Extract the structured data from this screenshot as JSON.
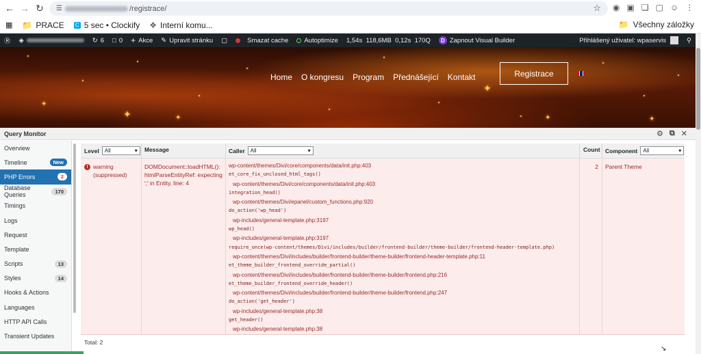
{
  "browser": {
    "url_path": "/registrace/",
    "bookmarks": [
      {
        "label": "PRACE",
        "icon": "folder-icon"
      },
      {
        "label": "5 sec • Clockify",
        "icon": "clockify-icon"
      },
      {
        "label": "Interní komu...",
        "icon": "sparkle-icon"
      }
    ],
    "all_bookmarks": "Všechny záložky"
  },
  "adminbar": {
    "comments": "0",
    "updates": "6",
    "new": "Akce",
    "edit": "Upravit stránku",
    "clear_cache": "Smazat cache",
    "autoptimize": "Autoptimize",
    "stats": "1,54s  118,6MB  0,12s  170Q",
    "visual_builder": "Zapnout Visual Builder",
    "logged_in": "Přihlášený uživatel: wpaservis"
  },
  "site_nav": {
    "items": [
      "Home",
      "O kongresu",
      "Program",
      "Přednášející",
      "Kontakt"
    ],
    "register": "Registrace"
  },
  "qm": {
    "title": "Query Monitor",
    "sidebar": [
      {
        "label": "Overview",
        "badge": ""
      },
      {
        "label": "Timeline",
        "badge": "New",
        "badge_style": "blue"
      },
      {
        "label": "PHP Errors",
        "badge": "2",
        "active": true,
        "badge_style": "red"
      },
      {
        "label": "Database Queries",
        "badge": "170"
      },
      {
        "label": "Timings",
        "badge": ""
      },
      {
        "label": "Logs",
        "badge": ""
      },
      {
        "label": "Request",
        "badge": ""
      },
      {
        "label": "Template",
        "badge": ""
      },
      {
        "label": "Scripts",
        "badge": "13"
      },
      {
        "label": "Styles",
        "badge": "14"
      },
      {
        "label": "Hooks & Actions",
        "badge": ""
      },
      {
        "label": "Languages",
        "badge": ""
      },
      {
        "label": "HTTP API Calls",
        "badge": ""
      },
      {
        "label": "Transient Updates",
        "badge": ""
      }
    ],
    "columns": {
      "level": "Level",
      "level_filter": "All",
      "message": "Message",
      "caller": "Caller",
      "caller_filter": "All",
      "count": "Count",
      "component": "Component",
      "component_filter": "All"
    },
    "error": {
      "level": "warning",
      "level_note": "(suppressed)",
      "message": "DOMDocument::loadHTML(): htmlParseEntityRef: expecting ';' in Entity, line: 4",
      "count": "2",
      "component": "Parent Theme",
      "caller": [
        {
          "t": "path",
          "text": "wp-content/themes/Divi/core/components/data/init.php:403",
          "indent": false
        },
        {
          "t": "fn",
          "text": "et_core_fix_unclosed_html_tags()"
        },
        {
          "t": "path",
          "text": "wp-content/themes/Divi/core/components/data/init.php:403",
          "indent": true
        },
        {
          "t": "fn",
          "text": "integration_head()"
        },
        {
          "t": "path",
          "text": "wp-content/themes/Divi/epanel/custom_functions.php:920",
          "indent": true
        },
        {
          "t": "fn",
          "text": "do_action('wp_head')"
        },
        {
          "t": "path",
          "text": "wp-includes/general-template.php:3197",
          "indent": true
        },
        {
          "t": "fn",
          "text": "wp_head()"
        },
        {
          "t": "path",
          "text": "wp-includes/general-template.php:3197",
          "indent": true
        },
        {
          "t": "fn",
          "text": "require_once(wp-content/themes/Divi/includes/builder/frontend-builder/theme-builder/frontend-header-template.php)"
        },
        {
          "t": "path",
          "text": "wp-content/themes/Divi/includes/builder/frontend-builder/theme-builder/frontend-header-template.php:11",
          "indent": true
        },
        {
          "t": "fn",
          "text": "et_theme_builder_frontend_override_partial()"
        },
        {
          "t": "path",
          "text": "wp-content/themes/Divi/includes/builder/frontend-builder/theme-builder/frontend.php:216",
          "indent": true
        },
        {
          "t": "fn",
          "text": "et_theme_builder_frontend_override_header()"
        },
        {
          "t": "path",
          "text": "wp-content/themes/Divi/includes/builder/frontend-builder/theme-builder/frontend.php:247",
          "indent": true
        },
        {
          "t": "fn",
          "text": "do_action('get_header')"
        },
        {
          "t": "path",
          "text": "wp-includes/general-template.php:38",
          "indent": true
        },
        {
          "t": "fn",
          "text": "get_header()"
        },
        {
          "t": "path",
          "text": "wp-includes/general-template.php:38",
          "indent": true
        }
      ]
    },
    "total": "Total: 2"
  }
}
